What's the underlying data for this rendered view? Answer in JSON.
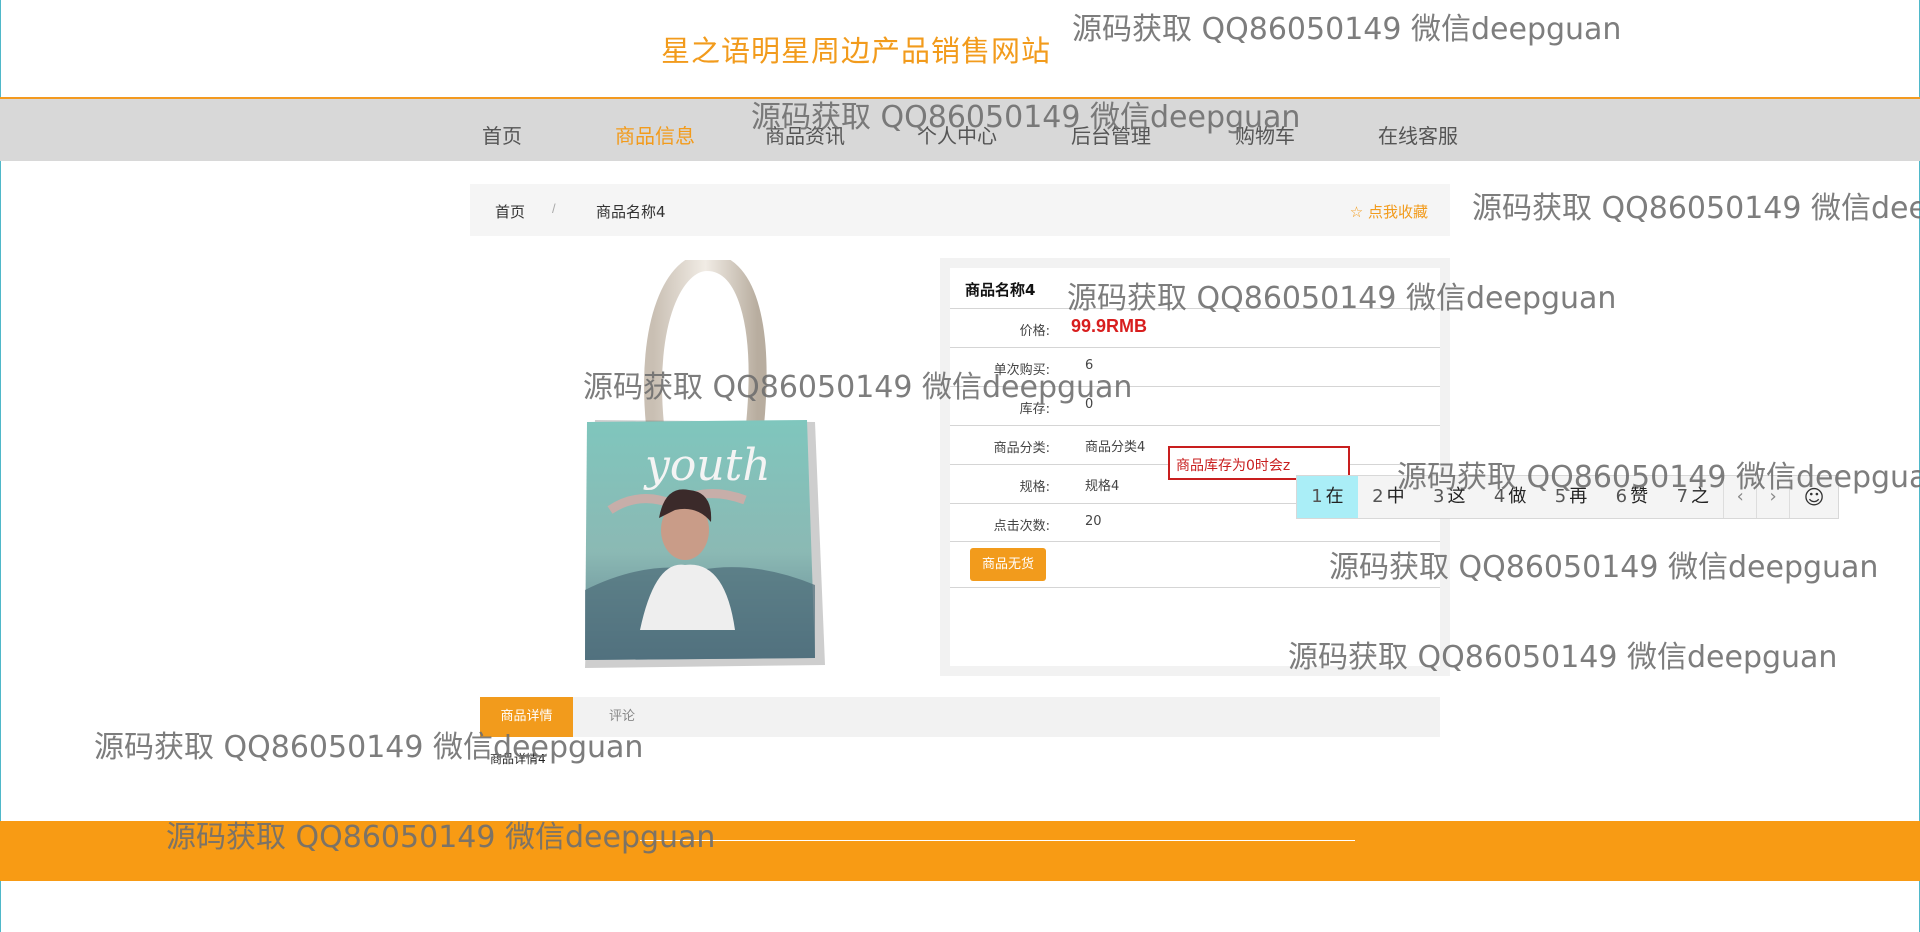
{
  "header": {
    "site_title": "星之语明星周边产品销售网站"
  },
  "nav": {
    "items": [
      {
        "label": "首页"
      },
      {
        "label": "商品信息"
      },
      {
        "label": "商品资讯"
      },
      {
        "label": "个人中心"
      },
      {
        "label": "后台管理"
      },
      {
        "label": "购物车"
      },
      {
        "label": "在线客服"
      }
    ],
    "active_index": 1
  },
  "breadcrumb": {
    "home": "首页",
    "separator": "/",
    "current": "商品名称4",
    "favorite": "点我收藏"
  },
  "product": {
    "name": "商品名称4",
    "price_label": "价格:",
    "price": "99.9RMB",
    "rows": [
      {
        "label": "单次购买:",
        "value": "6"
      },
      {
        "label": "库存:",
        "value": "0"
      },
      {
        "label": "商品分类:",
        "value": "商品分类4"
      },
      {
        "label": "规格:",
        "value": "规格4"
      },
      {
        "label": "点击次数:",
        "value": "20"
      }
    ],
    "out_of_stock_button": "商品无货"
  },
  "ime": {
    "composition": "商品库存为0时会z",
    "candidates": [
      {
        "n": "1",
        "c": "在"
      },
      {
        "n": "2",
        "c": "中"
      },
      {
        "n": "3",
        "c": "这"
      },
      {
        "n": "4",
        "c": "做"
      },
      {
        "n": "5",
        "c": "再"
      },
      {
        "n": "6",
        "c": "赞"
      },
      {
        "n": "7",
        "c": "之"
      }
    ],
    "prev_icon": "chevron-left-icon",
    "next_icon": "chevron-right-icon",
    "emoji_icon": "smiley-icon"
  },
  "tabs": {
    "detail": "商品详情",
    "comments": "评论",
    "detail_content": "商品详情4"
  },
  "watermark": "源码获取 QQ86050149 微信deepguan",
  "colors": {
    "accent": "#f29b1c",
    "price": "#d81e1e",
    "footer": "#f89b14",
    "nav_bg": "#d8d8d8"
  }
}
